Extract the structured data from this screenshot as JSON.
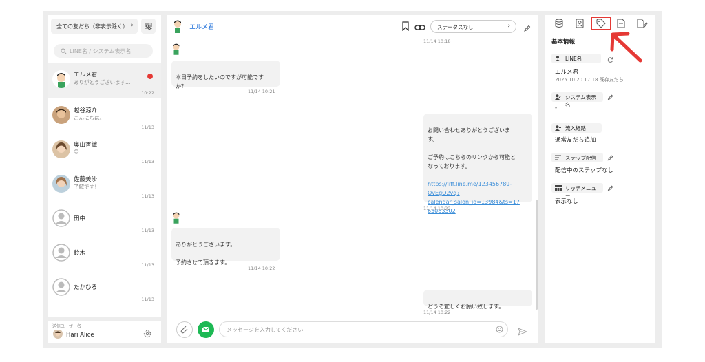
{
  "sidebar": {
    "filter_label": "全ての友だち（非表示除く）",
    "filter_chevron": "›",
    "search_placeholder": "LINE名 / システム表示名",
    "friends": [
      {
        "name": "エルメ君",
        "last_message": "ありがとうございます…",
        "time": "10:22",
        "unread": true
      },
      {
        "name": "越谷涼介",
        "last_message": "こんにちは。",
        "time": "11/13"
      },
      {
        "name": "奥山香織",
        "last_message": "😊",
        "time": "11/13"
      },
      {
        "name": "佐藤美沙",
        "last_message": "了解です！",
        "time": "11/13"
      },
      {
        "name": "田中",
        "last_message": "",
        "time": "11/13"
      },
      {
        "name": "鈴木",
        "last_message": "",
        "time": "11/13"
      },
      {
        "name": "たかひろ",
        "last_message": "",
        "time": "11/13"
      }
    ],
    "operator_label": "送信ユーザー名",
    "operator_name": "Hari Alice"
  },
  "chat": {
    "contact_name": "エルメ君",
    "status_label": "ステータスなし",
    "status_chevron": "›",
    "top_timestamp": "11/14 10:18",
    "messages": [
      {
        "side": "left",
        "text": "本日予約をしたいのですが可能です\nか？",
        "time": "11/14 10:21"
      },
      {
        "side": "right",
        "text": "お問い合わせありがとうございま\nす。\n\nご予約はこちらのリンクから可能と\nなっております。",
        "link": "https://liff.line.me/123456789-OvEgQ2vg?calendar_salon_id=13984&ts=1763083302",
        "link_lines": [
          "https://liff.line.me/123456789-",
          "OvEgQ2vq?",
          "calendar_salon_id=13984&ts=17",
          "63083302"
        ],
        "time": "11/14 10:22"
      },
      {
        "side": "left",
        "text": "ありがとうございます。\n\n予約させて頂きます。",
        "time": "11/14 10:22"
      },
      {
        "side": "right",
        "text": "どうぞ宜しくお願い致します。",
        "time": "11/14 10:22"
      }
    ],
    "composer_placeholder": "メッセージを入力してください"
  },
  "info": {
    "tabs": [
      "database-icon",
      "contact-card-icon",
      "tag-icon",
      "document-icon",
      "file-edit-icon"
    ],
    "selected_tab": "tag-icon",
    "section_title": "基本情報",
    "line_name_label": "LINE名",
    "line_name_value": "エルメ君",
    "line_name_meta": "2025.10.20 17:18 既存友だち",
    "system_name_label": "システム表示名",
    "system_name_value": "-",
    "inflow_label": "流入経路",
    "inflow_value": "通常友だち追加",
    "step_label": "ステップ配信",
    "step_value": "配信中のステップなし",
    "rich_menu_label": "リッチメニュー",
    "rich_menu_value": "表示なし"
  },
  "colors": {
    "accent_red": "#e53935",
    "link_blue": "#1e6fd9",
    "send_green": "#1db954"
  }
}
